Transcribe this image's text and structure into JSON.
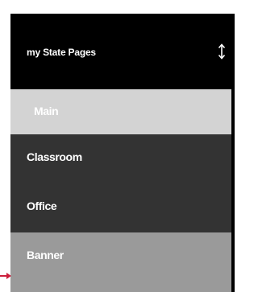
{
  "header": {
    "title": "my State Pages",
    "toggle_icon": "up-down-arrow-icon"
  },
  "menu": {
    "items": [
      {
        "label": "Main",
        "state": "selected"
      },
      {
        "label": "Classroom",
        "state": "default"
      },
      {
        "label": "Office",
        "state": "default"
      },
      {
        "label": "Banner",
        "state": "hover"
      }
    ]
  },
  "colors": {
    "header_bg": "#000000",
    "selected_bg": "#d3d3d3",
    "item_bg": "#333333",
    "hover_bg": "#9a9a9a",
    "text": "#ffffff",
    "pointer": "#cc1f3c"
  },
  "pointer_icon": "arrow-pointer-icon"
}
